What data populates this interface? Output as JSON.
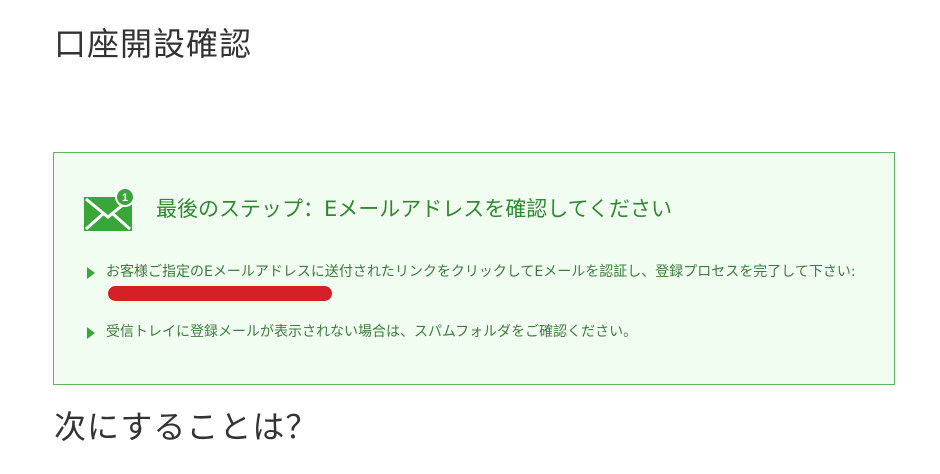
{
  "page": {
    "title": "口座開設確認"
  },
  "notice": {
    "icon": "mail-notification-icon",
    "badge_count": "1",
    "heading": "最後のステップ：Eメールアドレスを確認してください",
    "instruction_text": "お客様ご指定のEメールアドレスに送付されたリンクをクリックしてEメールを認証し、登録プロセスを完了して下さい:",
    "spam_text": "受信トレイに登録メールが表示されない場合は、スパムフォルダをご確認ください。"
  },
  "next": {
    "heading": "次にすることは？"
  },
  "colors": {
    "accent_green": "#3aa63a",
    "box_border": "#5cb85c",
    "box_background": "#f2fdf2",
    "redaction": "#d42026"
  }
}
